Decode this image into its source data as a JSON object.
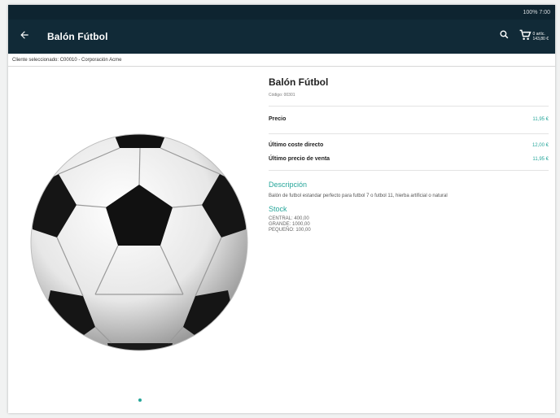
{
  "status": {
    "text": "100% 7:00"
  },
  "appbar": {
    "title": "Balón Fútbol",
    "cart_line1": "0 artíc.",
    "cart_line2": "143,80 €"
  },
  "client_bar": {
    "text": "Cliente seleccionado: C00010 - Corporación Acme"
  },
  "product": {
    "name": "Balón Fútbol",
    "code": "Código: 00301",
    "price_label": "Precio",
    "price_value": "11,95 €",
    "last_cost_label": "Último coste directo",
    "last_cost_value": "12,00 €",
    "last_sale_label": "Último precio de venta",
    "last_sale_value": "11,95 €"
  },
  "description": {
    "title": "Descripción",
    "text": "Balón de futbol estandar perfecto para futbol 7 o futbol 11, hierba artificial o natural"
  },
  "stock": {
    "title": "Stock",
    "lines": [
      "CENTRAL: 400,00",
      "GRANDE: 1000,00",
      "PEQUEÑO: 100,00"
    ]
  },
  "colors": {
    "appbar": "#112a37",
    "accent": "#26a69a"
  },
  "icons": {
    "back": "arrow-left-icon",
    "search": "search-icon",
    "cart": "cart-icon"
  },
  "carousel": {
    "current_page": 1,
    "total_pages": 1
  }
}
